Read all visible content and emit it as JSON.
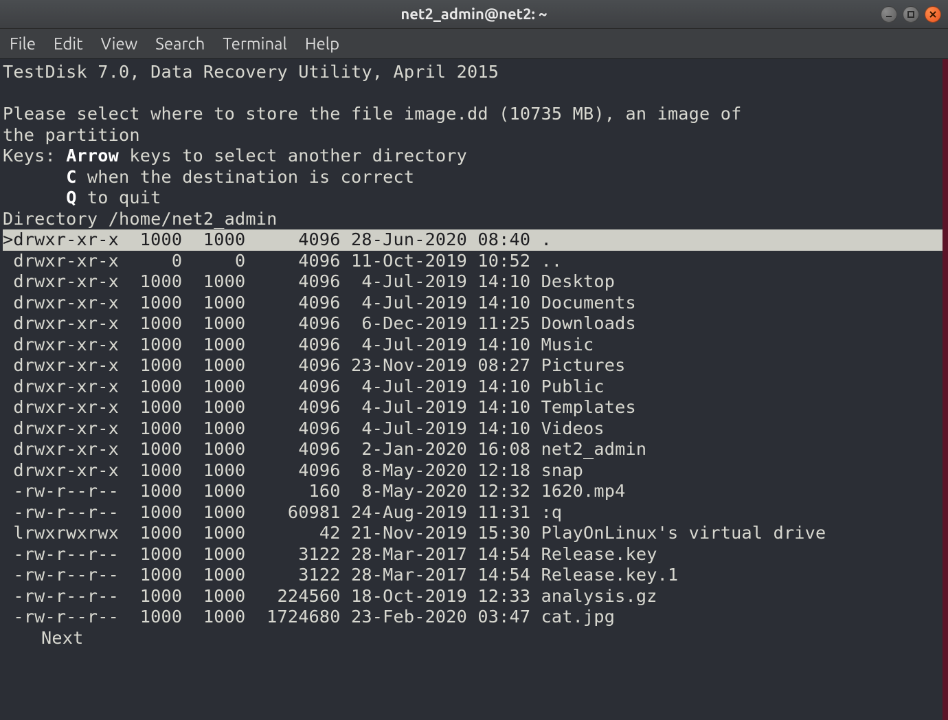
{
  "window": {
    "title": "net2_admin@net2: ~"
  },
  "menu": {
    "file": "File",
    "edit": "Edit",
    "view": "View",
    "search": "Search",
    "terminal": "Terminal",
    "help": "Help"
  },
  "program_header": "TestDisk 7.0, Data Recovery Utility, April 2015",
  "prompt_line": "Please select where to store the file image.dd (10735 MB), an image of the partition",
  "keys_label": "Keys: ",
  "keys": [
    {
      "k": "Arrow",
      "desc": " keys to select another directory"
    },
    {
      "k": "C",
      "desc": " when the destination is correct"
    },
    {
      "k": "Q",
      "desc": " to quit"
    }
  ],
  "directory_label": "Directory ",
  "directory_path": "/home/net2_admin",
  "selected_index": 0,
  "listing": [
    {
      "perm": "drwxr-xr-x",
      "uid": "1000",
      "gid": "1000",
      "size": "4096",
      "date": "28-Jun-2020",
      "time": "08:40",
      "name": "."
    },
    {
      "perm": "drwxr-xr-x",
      "uid": "0",
      "gid": "0",
      "size": "4096",
      "date": "11-Oct-2019",
      "time": "10:52",
      "name": ".."
    },
    {
      "perm": "drwxr-xr-x",
      "uid": "1000",
      "gid": "1000",
      "size": "4096",
      "date": " 4-Jul-2019",
      "time": "14:10",
      "name": "Desktop"
    },
    {
      "perm": "drwxr-xr-x",
      "uid": "1000",
      "gid": "1000",
      "size": "4096",
      "date": " 4-Jul-2019",
      "time": "14:10",
      "name": "Documents"
    },
    {
      "perm": "drwxr-xr-x",
      "uid": "1000",
      "gid": "1000",
      "size": "4096",
      "date": " 6-Dec-2019",
      "time": "11:25",
      "name": "Downloads"
    },
    {
      "perm": "drwxr-xr-x",
      "uid": "1000",
      "gid": "1000",
      "size": "4096",
      "date": " 4-Jul-2019",
      "time": "14:10",
      "name": "Music"
    },
    {
      "perm": "drwxr-xr-x",
      "uid": "1000",
      "gid": "1000",
      "size": "4096",
      "date": "23-Nov-2019",
      "time": "08:27",
      "name": "Pictures"
    },
    {
      "perm": "drwxr-xr-x",
      "uid": "1000",
      "gid": "1000",
      "size": "4096",
      "date": " 4-Jul-2019",
      "time": "14:10",
      "name": "Public"
    },
    {
      "perm": "drwxr-xr-x",
      "uid": "1000",
      "gid": "1000",
      "size": "4096",
      "date": " 4-Jul-2019",
      "time": "14:10",
      "name": "Templates"
    },
    {
      "perm": "drwxr-xr-x",
      "uid": "1000",
      "gid": "1000",
      "size": "4096",
      "date": " 4-Jul-2019",
      "time": "14:10",
      "name": "Videos"
    },
    {
      "perm": "drwxr-xr-x",
      "uid": "1000",
      "gid": "1000",
      "size": "4096",
      "date": " 2-Jan-2020",
      "time": "16:08",
      "name": "net2_admin"
    },
    {
      "perm": "drwxr-xr-x",
      "uid": "1000",
      "gid": "1000",
      "size": "4096",
      "date": " 8-May-2020",
      "time": "12:18",
      "name": "snap"
    },
    {
      "perm": "-rw-r--r--",
      "uid": "1000",
      "gid": "1000",
      "size": "160",
      "date": " 8-May-2020",
      "time": "12:32",
      "name": "1620.mp4"
    },
    {
      "perm": "-rw-r--r--",
      "uid": "1000",
      "gid": "1000",
      "size": "60981",
      "date": "24-Aug-2019",
      "time": "11:31",
      "name": ":q"
    },
    {
      "perm": "lrwxrwxrwx",
      "uid": "1000",
      "gid": "1000",
      "size": "42",
      "date": "21-Nov-2019",
      "time": "15:30",
      "name": "PlayOnLinux's virtual drive"
    },
    {
      "perm": "-rw-r--r--",
      "uid": "1000",
      "gid": "1000",
      "size": "3122",
      "date": "28-Mar-2017",
      "time": "14:54",
      "name": "Release.key"
    },
    {
      "perm": "-rw-r--r--",
      "uid": "1000",
      "gid": "1000",
      "size": "3122",
      "date": "28-Mar-2017",
      "time": "14:54",
      "name": "Release.key.1"
    },
    {
      "perm": "-rw-r--r--",
      "uid": "1000",
      "gid": "1000",
      "size": "224560",
      "date": "18-Oct-2019",
      "time": "12:33",
      "name": "analysis.gz"
    },
    {
      "perm": "-rw-r--r--",
      "uid": "1000",
      "gid": "1000",
      "size": "1724680",
      "date": "23-Feb-2020",
      "time": "03:47",
      "name": "cat.jpg"
    }
  ],
  "next_label": "Next"
}
